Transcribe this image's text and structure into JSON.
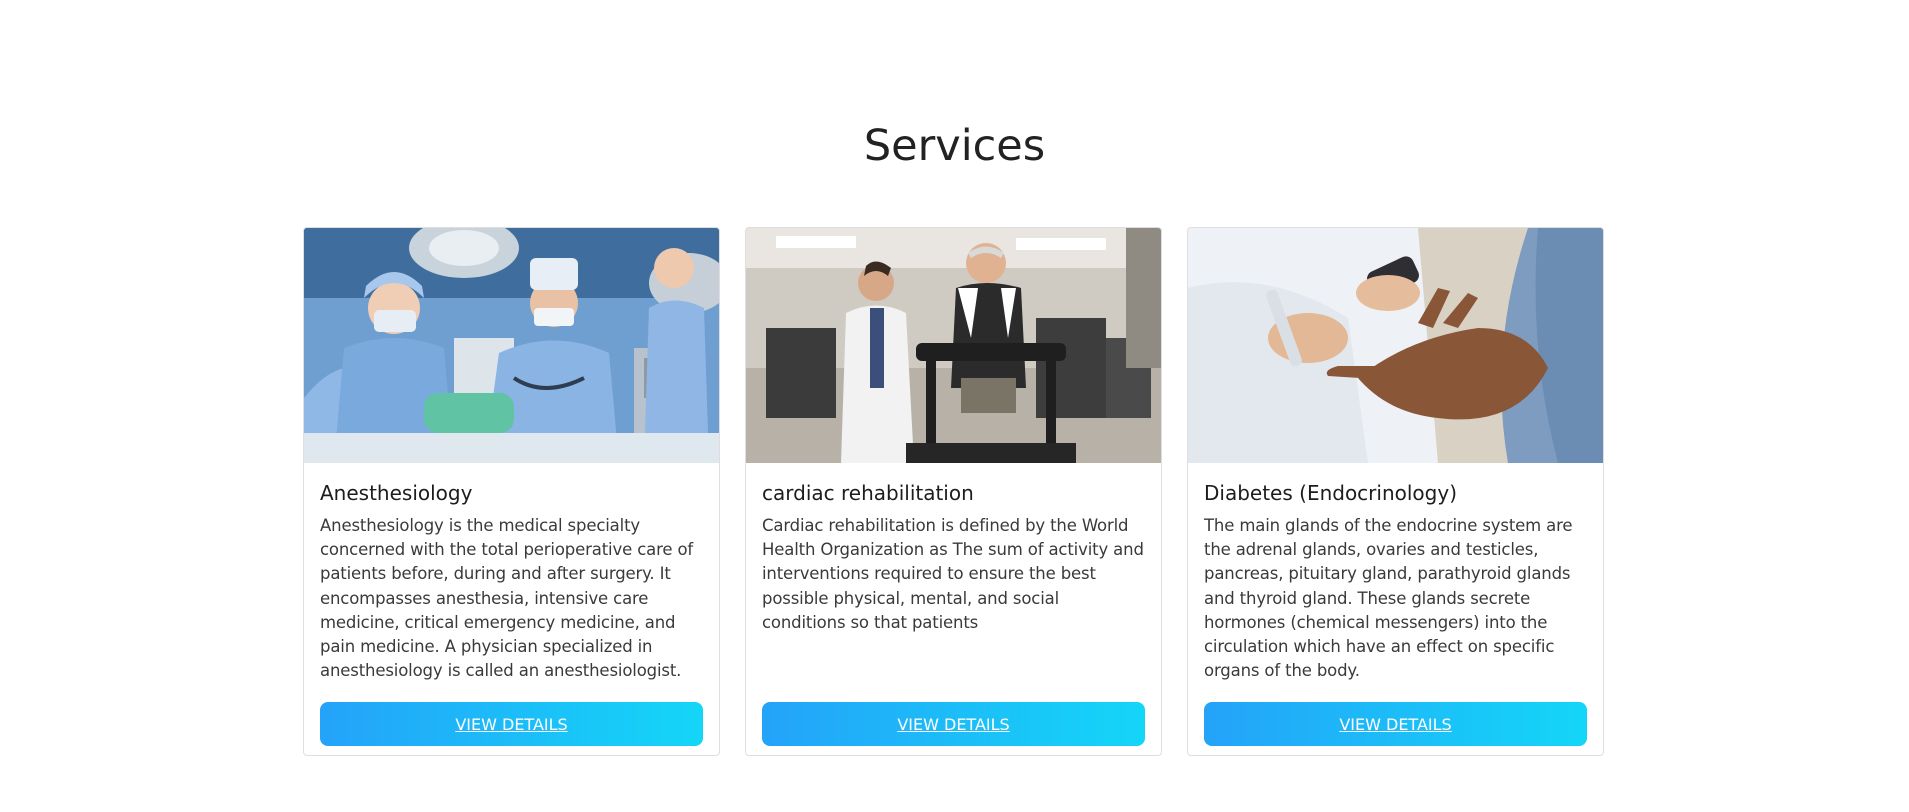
{
  "services": {
    "title": "Services",
    "cards": [
      {
        "image_icon": "surgery-team-photo",
        "title": "Anesthesiology",
        "description": "Anesthesiology is the medical specialty concerned with the total perioperative care of patients before, during and after surgery. It encompasses anesthesia, intensive care medicine, critical emergency medicine, and pain medicine. A physician specialized in anesthesiology is called an anesthesiologist.",
        "button_label": "VIEW DETAILS"
      },
      {
        "image_icon": "cardiac-rehab-photo",
        "title": "cardiac rehabilitation",
        "description": "Cardiac rehabilitation is defined by the World Health Organization as The sum of activity and interventions required to ensure the best possible physical, mental, and social conditions so that patients",
        "button_label": "VIEW DETAILS"
      },
      {
        "image_icon": "glucose-test-photo",
        "title": "Diabetes (Endocrinology)",
        "description": "The main glands of the endocrine system are the adrenal glands, ovaries and testicles, pancreas, pituitary gland, parathyroid glands and thyroid gland. These glands secrete hormones (chemical messengers) into the circulation which have an effect on specific organs of the body.",
        "button_label": "VIEW DETAILS"
      }
    ]
  },
  "colors": {
    "button_gradient_start": "#24a3f9",
    "button_gradient_end": "#14d6f8",
    "card_border": "#dedede",
    "title_text": "#222222"
  }
}
